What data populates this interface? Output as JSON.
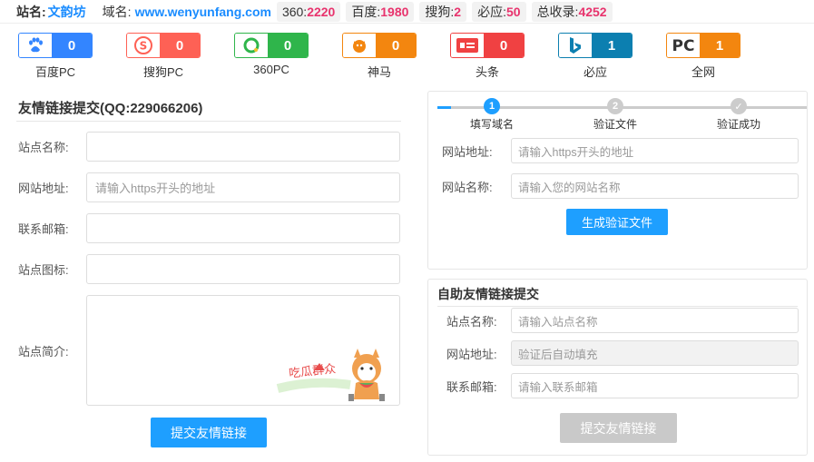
{
  "topbar": {
    "site_label": "站名:",
    "site_name": "文韵坊",
    "domain_label": "域名:",
    "domain": "www.wenyunfang.com",
    "stats": [
      {
        "label": "360:",
        "value": "2220"
      },
      {
        "label": "百度:",
        "value": "1980"
      },
      {
        "label": "搜狗:",
        "value": "2"
      },
      {
        "label": "必应:",
        "value": "50"
      },
      {
        "label": "总收录:",
        "value": "4252"
      }
    ]
  },
  "engines": [
    {
      "name": "百度PC",
      "count": "0",
      "icon": "paw-icon",
      "color": "#3385ff"
    },
    {
      "name": "搜狗PC",
      "count": "0",
      "icon": "sogou-icon",
      "color": "#fe6155"
    },
    {
      "name": "360PC",
      "count": "0",
      "icon": "so360-icon",
      "color": "#2fb54b"
    },
    {
      "name": "神马",
      "count": "0",
      "icon": "shenma-icon",
      "color": "#f3860f"
    },
    {
      "name": "头条",
      "count": "0",
      "icon": "toutiao-icon",
      "color": "#f04142"
    },
    {
      "name": "必应",
      "count": "1",
      "icon": "bing-icon",
      "color": "#0c7fb0"
    },
    {
      "name": "全网",
      "count": "1",
      "icon": "pc-icon",
      "color": "#f3860f"
    }
  ],
  "left_form": {
    "title": "友情链接提交(QQ:229066206)",
    "fields": [
      {
        "label": "站点名称:",
        "placeholder": ""
      },
      {
        "label": "网站地址:",
        "placeholder": "请输入https开头的地址"
      },
      {
        "label": "联系邮箱:",
        "placeholder": ""
      },
      {
        "label": "站点图标:",
        "placeholder": ""
      }
    ],
    "intro_label": "站点简介:",
    "sticker_text": "吃瓜群众",
    "submit_label": "提交友情链接"
  },
  "verify_panel": {
    "steps": [
      {
        "num": "1",
        "label": "填写域名"
      },
      {
        "num": "2",
        "label": "验证文件"
      },
      {
        "num": "✓",
        "label": "验证成功"
      }
    ],
    "fields": [
      {
        "label": "网站地址:",
        "placeholder": "请输入https开头的地址"
      },
      {
        "label": "网站名称:",
        "placeholder": "请输入您的网站名称"
      }
    ],
    "generate_label": "生成验证文件"
  },
  "auto_panel": {
    "title": "自助友情链接提交",
    "fields": [
      {
        "label": "站点名称:",
        "placeholder": "请输入站点名称"
      },
      {
        "label": "网站地址:",
        "placeholder": "验证后自动填充"
      },
      {
        "label": "联系邮箱:",
        "placeholder": "请输入联系邮箱"
      }
    ],
    "submit_label": "提交友情链接"
  },
  "colors": {
    "accent": "#1e9fff",
    "link": "#1a8cff",
    "stat_number": "#e8336d",
    "disabled_button": "#c9c9c9"
  }
}
